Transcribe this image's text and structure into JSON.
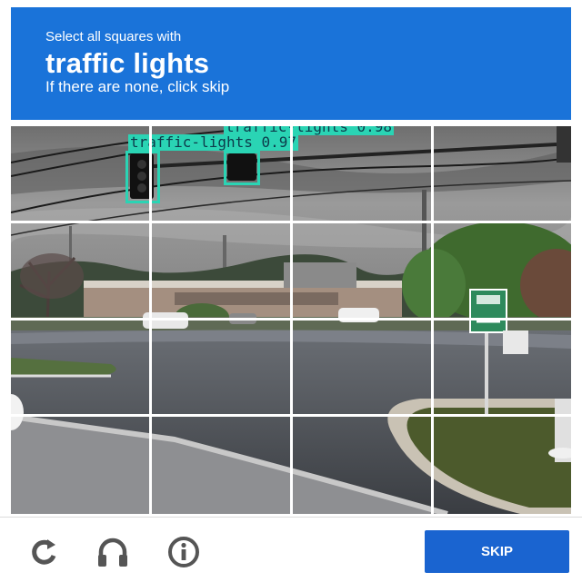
{
  "challenge": {
    "instruction_line1": "Select all squares with",
    "target": "traffic lights",
    "instruction_line2": "If there are none, click skip"
  },
  "grid": {
    "rows": 4,
    "cols": 4
  },
  "detections": [
    {
      "label": "traffic-lights 0.97"
    },
    {
      "label": "traffic-lights 0.98"
    }
  ],
  "footer": {
    "reload_icon": "reload-icon",
    "audio_icon": "headphones-icon",
    "info_icon": "info-icon",
    "skip_label": "SKIP"
  },
  "colors": {
    "header_bg": "#1a73d9",
    "detection_box": "#2ad4b4",
    "skip_button": "#1a64d0"
  }
}
